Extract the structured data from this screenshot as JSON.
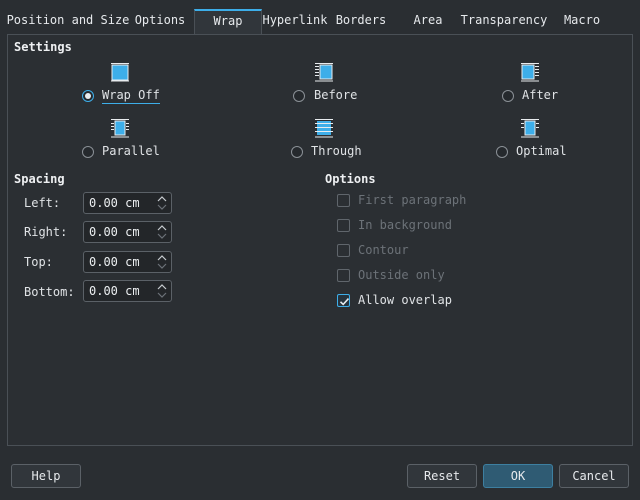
{
  "tabs": [
    {
      "label": "Position and Size"
    },
    {
      "label": "Options"
    },
    {
      "label": "Wrap"
    },
    {
      "label": "Hyperlink"
    },
    {
      "label": "Borders"
    },
    {
      "label": "Area"
    },
    {
      "label": "Transparency"
    },
    {
      "label": "Macro"
    }
  ],
  "settings": {
    "title": "Settings",
    "options": [
      {
        "label": "Wrap Off",
        "selected": true
      },
      {
        "label": "Before",
        "selected": false
      },
      {
        "label": "After",
        "selected": false
      },
      {
        "label": "Parallel",
        "selected": false
      },
      {
        "label": "Through",
        "selected": false
      },
      {
        "label": "Optimal",
        "selected": false
      }
    ]
  },
  "spacing": {
    "title": "Spacing",
    "fields": [
      {
        "label": "Left:",
        "value": "0.00 cm"
      },
      {
        "label": "Right:",
        "value": "0.00 cm"
      },
      {
        "label": "Top:",
        "value": "0.00 cm"
      },
      {
        "label": "Bottom:",
        "value": "0.00 cm"
      }
    ]
  },
  "options": {
    "title": "Options",
    "items": [
      {
        "label": "First paragraph",
        "checked": false,
        "enabled": false
      },
      {
        "label": "In background",
        "checked": false,
        "enabled": false
      },
      {
        "label": "Contour",
        "checked": false,
        "enabled": false
      },
      {
        "label": "Outside only",
        "checked": false,
        "enabled": false
      },
      {
        "label": "Allow overlap",
        "checked": true,
        "enabled": true
      }
    ]
  },
  "buttons": {
    "help": "Help",
    "reset": "Reset",
    "ok": "OK",
    "cancel": "Cancel"
  },
  "colors": {
    "accent": "#3daee9",
    "background": "#2a2e32"
  }
}
